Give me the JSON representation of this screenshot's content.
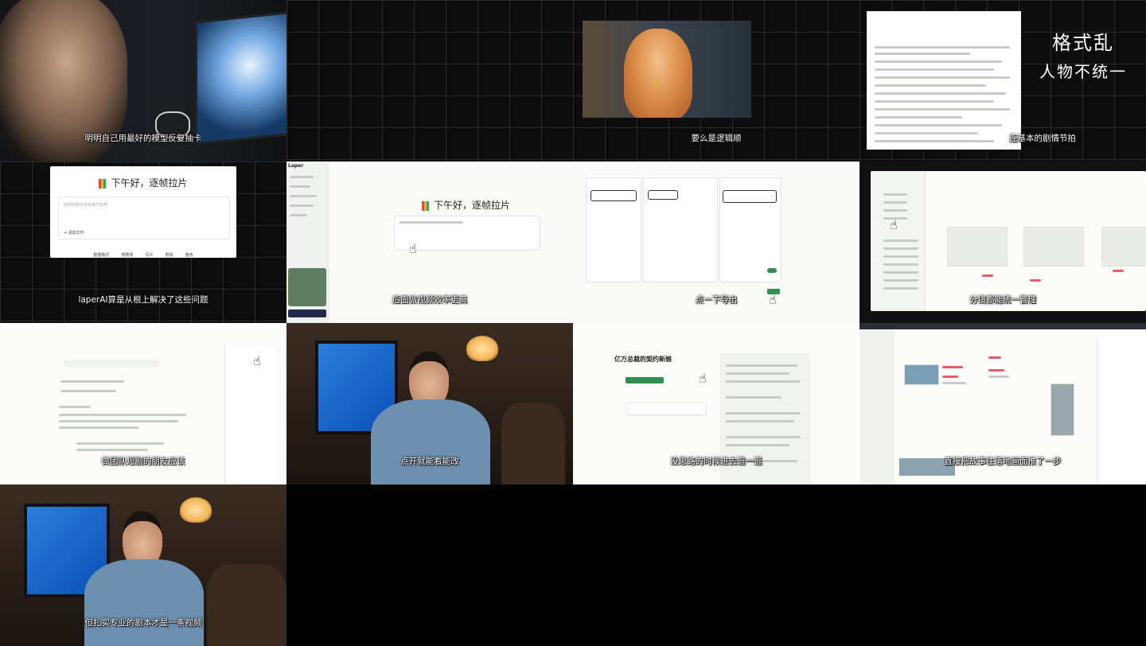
{
  "tiles": {
    "t1": {
      "subtitle": "明明自己用最好的模型反复抽卡"
    },
    "t3": {
      "subtitle": "要么是逻辑顺"
    },
    "t4": {
      "subtitle": "连基本的剧情节拍",
      "overlay_line1": "格式乱",
      "overlay_line2": "人物不统一"
    },
    "t5": {
      "greeting": "下午好，逐帧拉片",
      "input_placeholder": "把你的剧本放进来开始吧",
      "upload": "+ 添加文件",
      "chips": [
        "整理格式",
        "修剧情",
        "写片",
        "剧情",
        "角色"
      ],
      "subtitle": "laperAI算是从根上解决了这些问题"
    },
    "t6": {
      "brand": "Laper",
      "greeting": "下午好，逐帧拉片",
      "subtitle": "后面做视频效率更高"
    },
    "t7": {
      "subtitle": "点一下导出"
    },
    "t8": {
      "subtitle": "分镜都能统一管理"
    },
    "t9": {
      "subtitle": "做团队短剧的朋友应该"
    },
    "t10": {
      "subtitle": "点开就能看能改"
    },
    "t11": {
      "doc_title": "亿万总裁的契约新娘",
      "subtitle": "没思路的时候进去逛一逛"
    },
    "t12": {
      "subtitle": "直接把故事往落地画面推了一步"
    },
    "t13": {
      "subtitle": "但扎实专业的剧本才是一条视频"
    }
  },
  "colors": {
    "accent_red": "#e85c6a",
    "accent_green": "#3aa35a",
    "monitor_blue": "#1f6fd0"
  }
}
